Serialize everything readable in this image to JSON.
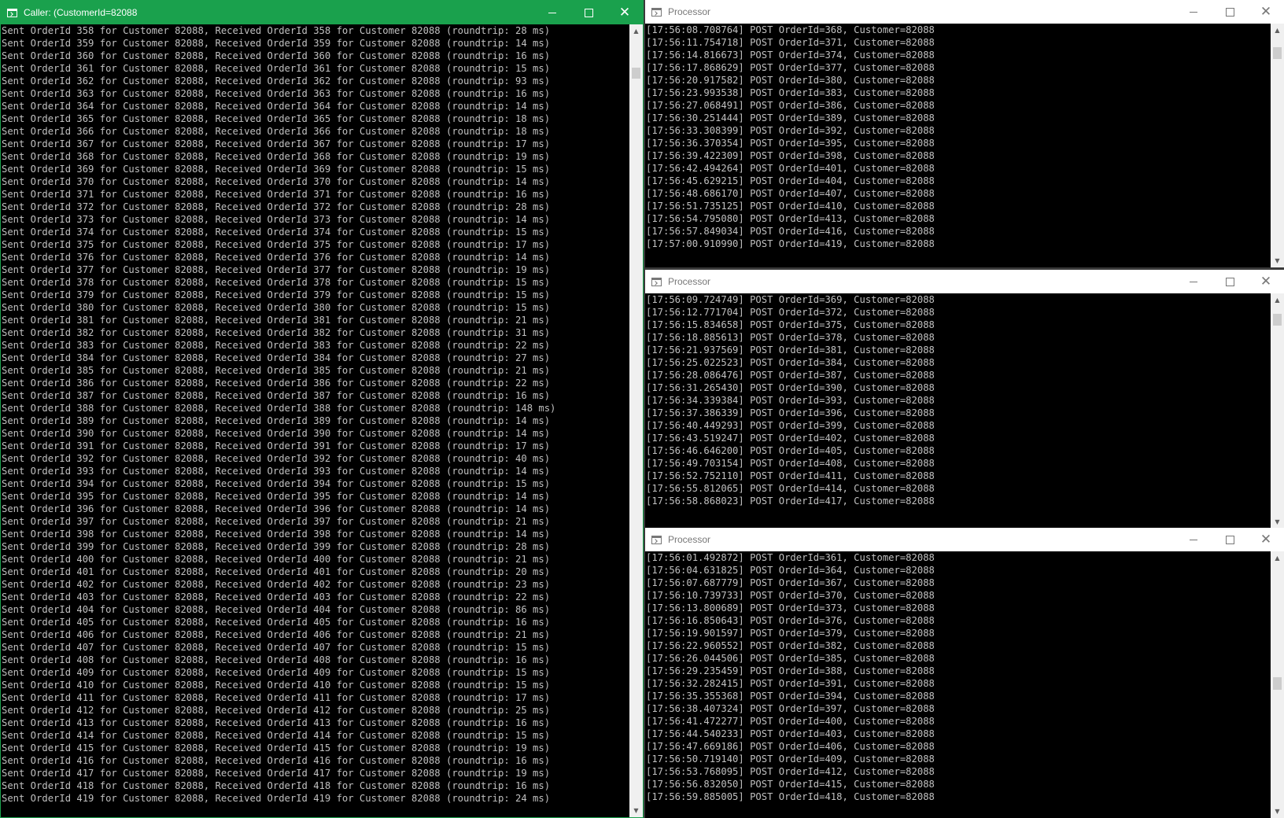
{
  "caller": {
    "title": "Caller: (CustomerId=82088",
    "lines": [
      "Sent OrderId 358 for Customer 82088, Received OrderId 358 for Customer 82088 (roundtrip: 28 ms)",
      "Sent OrderId 359 for Customer 82088, Received OrderId 359 for Customer 82088 (roundtrip: 14 ms)",
      "Sent OrderId 360 for Customer 82088, Received OrderId 360 for Customer 82088 (roundtrip: 16 ms)",
      "Sent OrderId 361 for Customer 82088, Received OrderId 361 for Customer 82088 (roundtrip: 15 ms)",
      "Sent OrderId 362 for Customer 82088, Received OrderId 362 for Customer 82088 (roundtrip: 93 ms)",
      "Sent OrderId 363 for Customer 82088, Received OrderId 363 for Customer 82088 (roundtrip: 16 ms)",
      "Sent OrderId 364 for Customer 82088, Received OrderId 364 for Customer 82088 (roundtrip: 14 ms)",
      "Sent OrderId 365 for Customer 82088, Received OrderId 365 for Customer 82088 (roundtrip: 18 ms)",
      "Sent OrderId 366 for Customer 82088, Received OrderId 366 for Customer 82088 (roundtrip: 18 ms)",
      "Sent OrderId 367 for Customer 82088, Received OrderId 367 for Customer 82088 (roundtrip: 17 ms)",
      "Sent OrderId 368 for Customer 82088, Received OrderId 368 for Customer 82088 (roundtrip: 19 ms)",
      "Sent OrderId 369 for Customer 82088, Received OrderId 369 for Customer 82088 (roundtrip: 15 ms)",
      "Sent OrderId 370 for Customer 82088, Received OrderId 370 for Customer 82088 (roundtrip: 14 ms)",
      "Sent OrderId 371 for Customer 82088, Received OrderId 371 for Customer 82088 (roundtrip: 16 ms)",
      "Sent OrderId 372 for Customer 82088, Received OrderId 372 for Customer 82088 (roundtrip: 28 ms)",
      "Sent OrderId 373 for Customer 82088, Received OrderId 373 for Customer 82088 (roundtrip: 14 ms)",
      "Sent OrderId 374 for Customer 82088, Received OrderId 374 for Customer 82088 (roundtrip: 15 ms)",
      "Sent OrderId 375 for Customer 82088, Received OrderId 375 for Customer 82088 (roundtrip: 17 ms)",
      "Sent OrderId 376 for Customer 82088, Received OrderId 376 for Customer 82088 (roundtrip: 14 ms)",
      "Sent OrderId 377 for Customer 82088, Received OrderId 377 for Customer 82088 (roundtrip: 19 ms)",
      "Sent OrderId 378 for Customer 82088, Received OrderId 378 for Customer 82088 (roundtrip: 15 ms)",
      "Sent OrderId 379 for Customer 82088, Received OrderId 379 for Customer 82088 (roundtrip: 15 ms)",
      "Sent OrderId 380 for Customer 82088, Received OrderId 380 for Customer 82088 (roundtrip: 15 ms)",
      "Sent OrderId 381 for Customer 82088, Received OrderId 381 for Customer 82088 (roundtrip: 21 ms)",
      "Sent OrderId 382 for Customer 82088, Received OrderId 382 for Customer 82088 (roundtrip: 31 ms)",
      "Sent OrderId 383 for Customer 82088, Received OrderId 383 for Customer 82088 (roundtrip: 22 ms)",
      "Sent OrderId 384 for Customer 82088, Received OrderId 384 for Customer 82088 (roundtrip: 27 ms)",
      "Sent OrderId 385 for Customer 82088, Received OrderId 385 for Customer 82088 (roundtrip: 21 ms)",
      "Sent OrderId 386 for Customer 82088, Received OrderId 386 for Customer 82088 (roundtrip: 22 ms)",
      "Sent OrderId 387 for Customer 82088, Received OrderId 387 for Customer 82088 (roundtrip: 16 ms)",
      "Sent OrderId 388 for Customer 82088, Received OrderId 388 for Customer 82088 (roundtrip: 148 ms)",
      "Sent OrderId 389 for Customer 82088, Received OrderId 389 for Customer 82088 (roundtrip: 14 ms)",
      "Sent OrderId 390 for Customer 82088, Received OrderId 390 for Customer 82088 (roundtrip: 14 ms)",
      "Sent OrderId 391 for Customer 82088, Received OrderId 391 for Customer 82088 (roundtrip: 17 ms)",
      "Sent OrderId 392 for Customer 82088, Received OrderId 392 for Customer 82088 (roundtrip: 40 ms)",
      "Sent OrderId 393 for Customer 82088, Received OrderId 393 for Customer 82088 (roundtrip: 14 ms)",
      "Sent OrderId 394 for Customer 82088, Received OrderId 394 for Customer 82088 (roundtrip: 15 ms)",
      "Sent OrderId 395 for Customer 82088, Received OrderId 395 for Customer 82088 (roundtrip: 14 ms)",
      "Sent OrderId 396 for Customer 82088, Received OrderId 396 for Customer 82088 (roundtrip: 14 ms)",
      "Sent OrderId 397 for Customer 82088, Received OrderId 397 for Customer 82088 (roundtrip: 21 ms)",
      "Sent OrderId 398 for Customer 82088, Received OrderId 398 for Customer 82088 (roundtrip: 14 ms)",
      "Sent OrderId 399 for Customer 82088, Received OrderId 399 for Customer 82088 (roundtrip: 28 ms)",
      "Sent OrderId 400 for Customer 82088, Received OrderId 400 for Customer 82088 (roundtrip: 21 ms)",
      "Sent OrderId 401 for Customer 82088, Received OrderId 401 for Customer 82088 (roundtrip: 20 ms)",
      "Sent OrderId 402 for Customer 82088, Received OrderId 402 for Customer 82088 (roundtrip: 23 ms)",
      "Sent OrderId 403 for Customer 82088, Received OrderId 403 for Customer 82088 (roundtrip: 22 ms)",
      "Sent OrderId 404 for Customer 82088, Received OrderId 404 for Customer 82088 (roundtrip: 86 ms)",
      "Sent OrderId 405 for Customer 82088, Received OrderId 405 for Customer 82088 (roundtrip: 16 ms)",
      "Sent OrderId 406 for Customer 82088, Received OrderId 406 for Customer 82088 (roundtrip: 21 ms)",
      "Sent OrderId 407 for Customer 82088, Received OrderId 407 for Customer 82088 (roundtrip: 15 ms)",
      "Sent OrderId 408 for Customer 82088, Received OrderId 408 for Customer 82088 (roundtrip: 16 ms)",
      "Sent OrderId 409 for Customer 82088, Received OrderId 409 for Customer 82088 (roundtrip: 15 ms)",
      "Sent OrderId 410 for Customer 82088, Received OrderId 410 for Customer 82088 (roundtrip: 15 ms)",
      "Sent OrderId 411 for Customer 82088, Received OrderId 411 for Customer 82088 (roundtrip: 17 ms)",
      "Sent OrderId 412 for Customer 82088, Received OrderId 412 for Customer 82088 (roundtrip: 25 ms)",
      "Sent OrderId 413 for Customer 82088, Received OrderId 413 for Customer 82088 (roundtrip: 16 ms)",
      "Sent OrderId 414 for Customer 82088, Received OrderId 414 for Customer 82088 (roundtrip: 15 ms)",
      "Sent OrderId 415 for Customer 82088, Received OrderId 415 for Customer 82088 (roundtrip: 19 ms)",
      "Sent OrderId 416 for Customer 82088, Received OrderId 416 for Customer 82088 (roundtrip: 16 ms)",
      "Sent OrderId 417 for Customer 82088, Received OrderId 417 for Customer 82088 (roundtrip: 19 ms)",
      "Sent OrderId 418 for Customer 82088, Received OrderId 418 for Customer 82088 (roundtrip: 16 ms)",
      "Sent OrderId 419 for Customer 82088, Received OrderId 419 for Customer 82088 (roundtrip: 24 ms)"
    ]
  },
  "processors": [
    {
      "title": "Processor",
      "lines": [
        "[17:56:08.708764] POST OrderId=368, Customer=82088",
        "[17:56:11.754718] POST OrderId=371, Customer=82088",
        "[17:56:14.816673] POST OrderId=374, Customer=82088",
        "[17:56:17.868629] POST OrderId=377, Customer=82088",
        "[17:56:20.917582] POST OrderId=380, Customer=82088",
        "[17:56:23.993538] POST OrderId=383, Customer=82088",
        "[17:56:27.068491] POST OrderId=386, Customer=82088",
        "[17:56:30.251444] POST OrderId=389, Customer=82088",
        "[17:56:33.308399] POST OrderId=392, Customer=82088",
        "[17:56:36.370354] POST OrderId=395, Customer=82088",
        "[17:56:39.422309] POST OrderId=398, Customer=82088",
        "[17:56:42.494264] POST OrderId=401, Customer=82088",
        "[17:56:45.629215] POST OrderId=404, Customer=82088",
        "[17:56:48.686170] POST OrderId=407, Customer=82088",
        "[17:56:51.735125] POST OrderId=410, Customer=82088",
        "[17:56:54.795080] POST OrderId=413, Customer=82088",
        "[17:56:57.849034] POST OrderId=416, Customer=82088",
        "[17:57:00.910990] POST OrderId=419, Customer=82088"
      ]
    },
    {
      "title": "Processor",
      "lines": [
        "[17:56:09.724749] POST OrderId=369, Customer=82088",
        "[17:56:12.771704] POST OrderId=372, Customer=82088",
        "[17:56:15.834658] POST OrderId=375, Customer=82088",
        "[17:56:18.885613] POST OrderId=378, Customer=82088",
        "[17:56:21.937569] POST OrderId=381, Customer=82088",
        "[17:56:25.022523] POST OrderId=384, Customer=82088",
        "[17:56:28.086476] POST OrderId=387, Customer=82088",
        "[17:56:31.265430] POST OrderId=390, Customer=82088",
        "[17:56:34.339384] POST OrderId=393, Customer=82088",
        "[17:56:37.386339] POST OrderId=396, Customer=82088",
        "[17:56:40.449293] POST OrderId=399, Customer=82088",
        "[17:56:43.519247] POST OrderId=402, Customer=82088",
        "[17:56:46.646200] POST OrderId=405, Customer=82088",
        "[17:56:49.703154] POST OrderId=408, Customer=82088",
        "[17:56:52.752110] POST OrderId=411, Customer=82088",
        "[17:56:55.812065] POST OrderId=414, Customer=82088",
        "[17:56:58.868023] POST OrderId=417, Customer=82088"
      ]
    },
    {
      "title": "Processor",
      "lines": [
        "[17:56:01.492872] POST OrderId=361, Customer=82088",
        "[17:56:04.631825] POST OrderId=364, Customer=82088",
        "[17:56:07.687779] POST OrderId=367, Customer=82088",
        "[17:56:10.739733] POST OrderId=370, Customer=82088",
        "[17:56:13.800689] POST OrderId=373, Customer=82088",
        "[17:56:16.850643] POST OrderId=376, Customer=82088",
        "[17:56:19.901597] POST OrderId=379, Customer=82088",
        "[17:56:22.960552] POST OrderId=382, Customer=82088",
        "[17:56:26.044506] POST OrderId=385, Customer=82088",
        "[17:56:29.235459] POST OrderId=388, Customer=82088",
        "[17:56:32.282415] POST OrderId=391, Customer=82088",
        "[17:56:35.355368] POST OrderId=394, Customer=82088",
        "[17:56:38.407324] POST OrderId=397, Customer=82088",
        "[17:56:41.472277] POST OrderId=400, Customer=82088",
        "[17:56:44.540233] POST OrderId=403, Customer=82088",
        "[17:56:47.669186] POST OrderId=406, Customer=82088",
        "[17:56:50.719140] POST OrderId=409, Customer=82088",
        "[17:56:53.768095] POST OrderId=412, Customer=82088",
        "[17:56:56.832050] POST OrderId=415, Customer=82088",
        "[17:56:59.885005] POST OrderId=418, Customer=82088"
      ]
    }
  ],
  "colors": {
    "active_titlebar": "#1aa14d",
    "console_text": "#c0c0c0",
    "console_bg": "#000000"
  }
}
